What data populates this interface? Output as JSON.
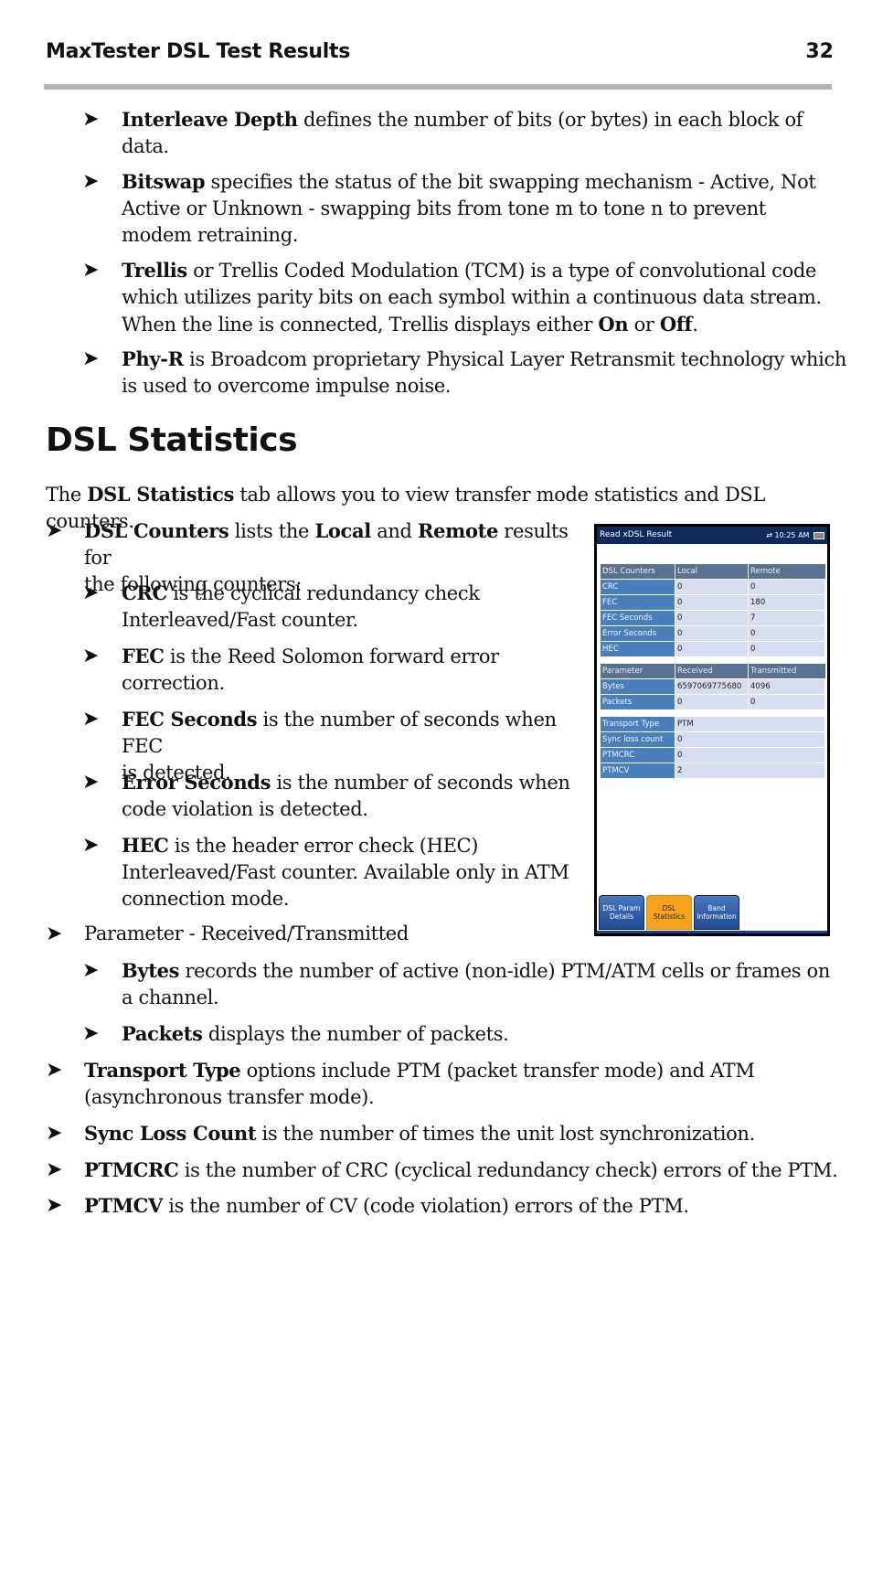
{
  "header": {
    "title": "MaxTester DSL Test Results",
    "page_number": "32"
  },
  "top_bullets": [
    {
      "term": "Interleave Depth",
      "text_lines": [
        " defines the number of bits (or bytes) in each block of",
        "data."
      ]
    },
    {
      "term": "Bitswap",
      "text_lines": [
        " specifies the status of the bit swapping mechanism - Active, Not",
        "Active or Unknown - swapping bits from tone m to tone n to prevent",
        "modem retraining."
      ]
    },
    {
      "term": "Trellis",
      "text_lines": [
        " or Trellis Coded Modulation (TCM) is a type of convolutional code",
        "which utilizes parity bits on each symbol within a continuous data stream.",
        "When the line is connected, Trellis displays either "
      ],
      "tail": {
        "on": "On",
        "or": " or ",
        "off": "Off",
        "end": "."
      }
    },
    {
      "term": "Phy-R",
      "text_lines": [
        " is Broadcom proprietary Physical Layer Retransmit technology which",
        "is used to overcome impulse noise."
      ]
    }
  ],
  "section": {
    "title": "DSL Statistics",
    "intro_pre": "The ",
    "intro_bold": "DSL Statistics",
    "intro_post": " tab allows you to view transfer mode statistics and DSL counters."
  },
  "dsl_counters": {
    "term": "DSL Counters",
    "t1": " lists the ",
    "local": "Local",
    "t2": " and ",
    "remote": "Remote",
    "t3": " results for",
    "line2": "the following counters:",
    "items": [
      {
        "term": "CRC",
        "lines": [
          " is the cyclical redundancy check",
          "Interleaved/Fast counter."
        ]
      },
      {
        "term": "FEC",
        "lines": [
          " is the Reed Solomon forward error",
          "correction."
        ]
      },
      {
        "term": "FEC Seconds",
        "lines": [
          " is the number of seconds when FEC",
          "is detected."
        ]
      },
      {
        "term": "Error Seconds",
        "lines": [
          " is the number of seconds when",
          "code violation is detected."
        ]
      },
      {
        "term": "HEC",
        "lines": [
          " is the header error check (HEC)",
          "Interleaved/Fast counter. Available only in ATM",
          "connection mode."
        ]
      }
    ]
  },
  "parameter": {
    "label": "Parameter - Received/Transmitted",
    "items": [
      {
        "term": "Bytes",
        "lines": [
          " records the number of active (non-idle) PTM/ATM cells or frames on",
          "a channel."
        ]
      },
      {
        "term": "Packets",
        "lines": [
          " displays the number of packets."
        ]
      }
    ]
  },
  "bottom_bullets": [
    {
      "term": "Transport Type",
      "lines": [
        " options include PTM (packet transfer mode) and ATM",
        "(asynchronous transfer mode)."
      ]
    },
    {
      "term": "Sync Loss Count",
      "lines": [
        " is the number of times the unit lost synchronization."
      ]
    },
    {
      "term": "PTMCRC",
      "lines": [
        " is the number of CRC (cyclical redundancy check) errors of the PTM."
      ]
    },
    {
      "term": "PTMCV",
      "lines": [
        " is the number of CV (code violation) errors of the PTM."
      ]
    }
  ],
  "bullet_glyph": "➤",
  "device": {
    "title": "Read xDSL Result",
    "time": "10:25 AM",
    "status_icon": "⇄",
    "counters": {
      "headers": [
        "DSL Counters",
        "Local",
        "Remote"
      ],
      "rows": [
        [
          "CRC",
          "0",
          "0"
        ],
        [
          "FEC",
          "0",
          "180"
        ],
        [
          "FEC Seconds",
          "0",
          "7"
        ],
        [
          "Error Seconds",
          "0",
          "0"
        ],
        [
          "HEC",
          "0",
          "0"
        ]
      ]
    },
    "params": {
      "headers": [
        "Parameter",
        "Received",
        "Transmitted"
      ],
      "rows": [
        [
          "Bytes",
          "6597069775680",
          "4096"
        ],
        [
          "Packets",
          "0",
          "0"
        ]
      ]
    },
    "transport": {
      "rows": [
        [
          "Transport Type",
          "PTM"
        ],
        [
          "Sync loss count",
          "0"
        ],
        [
          "PTMCRC",
          "0"
        ],
        [
          "PTMCV",
          "2"
        ]
      ]
    },
    "tabs": [
      {
        "label_line1": "DSL Param",
        "label_line2": "Details",
        "active": false
      },
      {
        "label_line1": "DSL Statistics",
        "label_line2": "",
        "active": true
      },
      {
        "label_line1": "Band",
        "label_line2": "Information",
        "active": false
      }
    ],
    "colors": {
      "titlebar": "#0f2a5c",
      "header_row": "#5a7292",
      "label_cell": "#4a7fbd",
      "value_cell": "#d8dcf0",
      "active_tab": "#f7a31c"
    }
  }
}
